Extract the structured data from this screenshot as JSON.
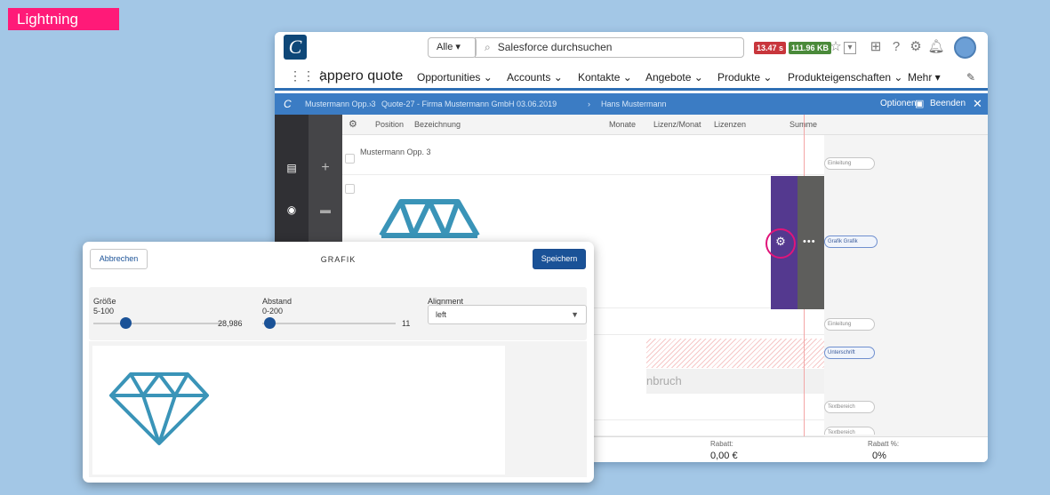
{
  "badge": "Lightning",
  "header": {
    "scope": "Alle",
    "search_placeholder": "Salesforce durchsuchen",
    "timer": "13.47 s",
    "size": "111.96 KB"
  },
  "nav": {
    "app_name": "appero quote",
    "items": [
      "Opportunities",
      "Accounts",
      "Kontakte",
      "Angebote",
      "Produkte",
      "Produkteigenschaften",
      "Mehr"
    ]
  },
  "breadcrumb": {
    "items": [
      "Mustermann Opp. 3",
      "Quote-27 - Firma Mustermann GmbH 03.06.2019",
      "Hans Mustermann"
    ],
    "options_label": "Optionen",
    "end_label": "Beenden"
  },
  "table": {
    "columns": [
      "Position",
      "Bezeichnung",
      "Monate",
      "Lizenz/Monat",
      "Lizenzen",
      "Summe"
    ],
    "first_row": "Mustermann Opp. 3",
    "page_break_fragment": "nbruch"
  },
  "blocks": [
    "Einleitung",
    "Grafik Grafik",
    "Einleitung",
    "Unterschrift",
    "Textbereich",
    "Textbereich"
  ],
  "footer": {
    "rabatt_label": "Rabatt:",
    "rabatt_value": "0,00 €",
    "rabatt_pct_label": "Rabatt %:",
    "rabatt_pct_value": "0%"
  },
  "dialog": {
    "cancel_label": "Abbrechen",
    "title": "GRAFIK",
    "save_label": "Speichern",
    "size_label": "Größe",
    "size_range": "5-100",
    "size_value": "28,986",
    "size_fraction": 0.25,
    "spacing_label": "Abstand",
    "spacing_range": "0-200",
    "spacing_value": "11",
    "spacing_fraction": 0.055,
    "alignment_label": "Alignment",
    "alignment_value": "left"
  },
  "colors": {
    "accent": "#1a5297",
    "brand_pink": "#ff1a78",
    "diamond": "#3a94b8",
    "purple_panel": "#54398f"
  }
}
